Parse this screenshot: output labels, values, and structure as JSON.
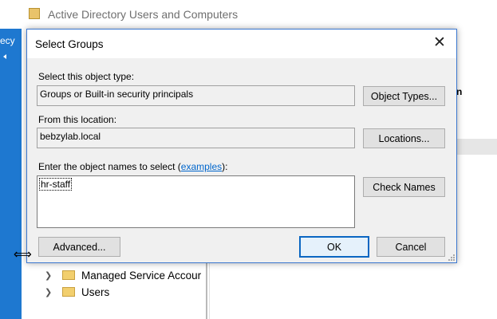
{
  "background_window": {
    "title": "Active Directory Users and Computers",
    "left_strip_text": "ecy",
    "right_panel_text": "n",
    "tree": [
      {
        "label": "Managed Service Accour"
      },
      {
        "label": "Users"
      }
    ]
  },
  "dialog": {
    "title": "Select Groups",
    "object_type_label": "Select this object type:",
    "object_type_value": "Groups or Built-in security principals",
    "object_types_button": "Object Types...",
    "location_label": "From this location:",
    "location_value": "bebzylab.local",
    "locations_button": "Locations...",
    "names_label": "Enter the object names to select (",
    "names_label_link": "examples",
    "names_label_end": "):",
    "names_value": "hr-staff",
    "check_names_button": "Check Names",
    "advanced_button": "Advanced...",
    "ok_button": "OK",
    "cancel_button": "Cancel"
  },
  "colors": {
    "accent": "#0a66c2",
    "strip": "#1e78d0",
    "link": "#0066cc"
  }
}
